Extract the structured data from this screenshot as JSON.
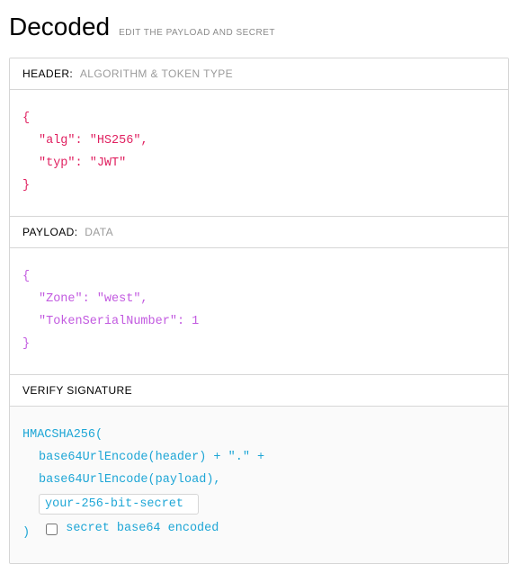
{
  "title": "Decoded",
  "subtitle": "EDIT THE PAYLOAD AND SECRET",
  "sections": {
    "header": {
      "label": "HEADER:",
      "sublabel": "ALGORITHM & TOKEN TYPE",
      "json": {
        "alg_key": "\"alg\"",
        "alg_val": "\"HS256\"",
        "typ_key": "\"typ\"",
        "typ_val": "\"JWT\""
      }
    },
    "payload": {
      "label": "PAYLOAD:",
      "sublabel": "DATA",
      "json": {
        "zone_key": "\"Zone\"",
        "zone_val": "\"west\"",
        "tsn_key": "\"TokenSerialNumber\"",
        "tsn_val": "1"
      }
    },
    "signature": {
      "label": "VERIFY SIGNATURE",
      "func": "HMACSHA256(",
      "line1": "base64UrlEncode(header) + \".\" +",
      "line2": "base64UrlEncode(payload),",
      "secret_value": "your-256-bit-secret",
      "close_paren": ")",
      "checkbox_label": "secret base64 encoded"
    }
  }
}
